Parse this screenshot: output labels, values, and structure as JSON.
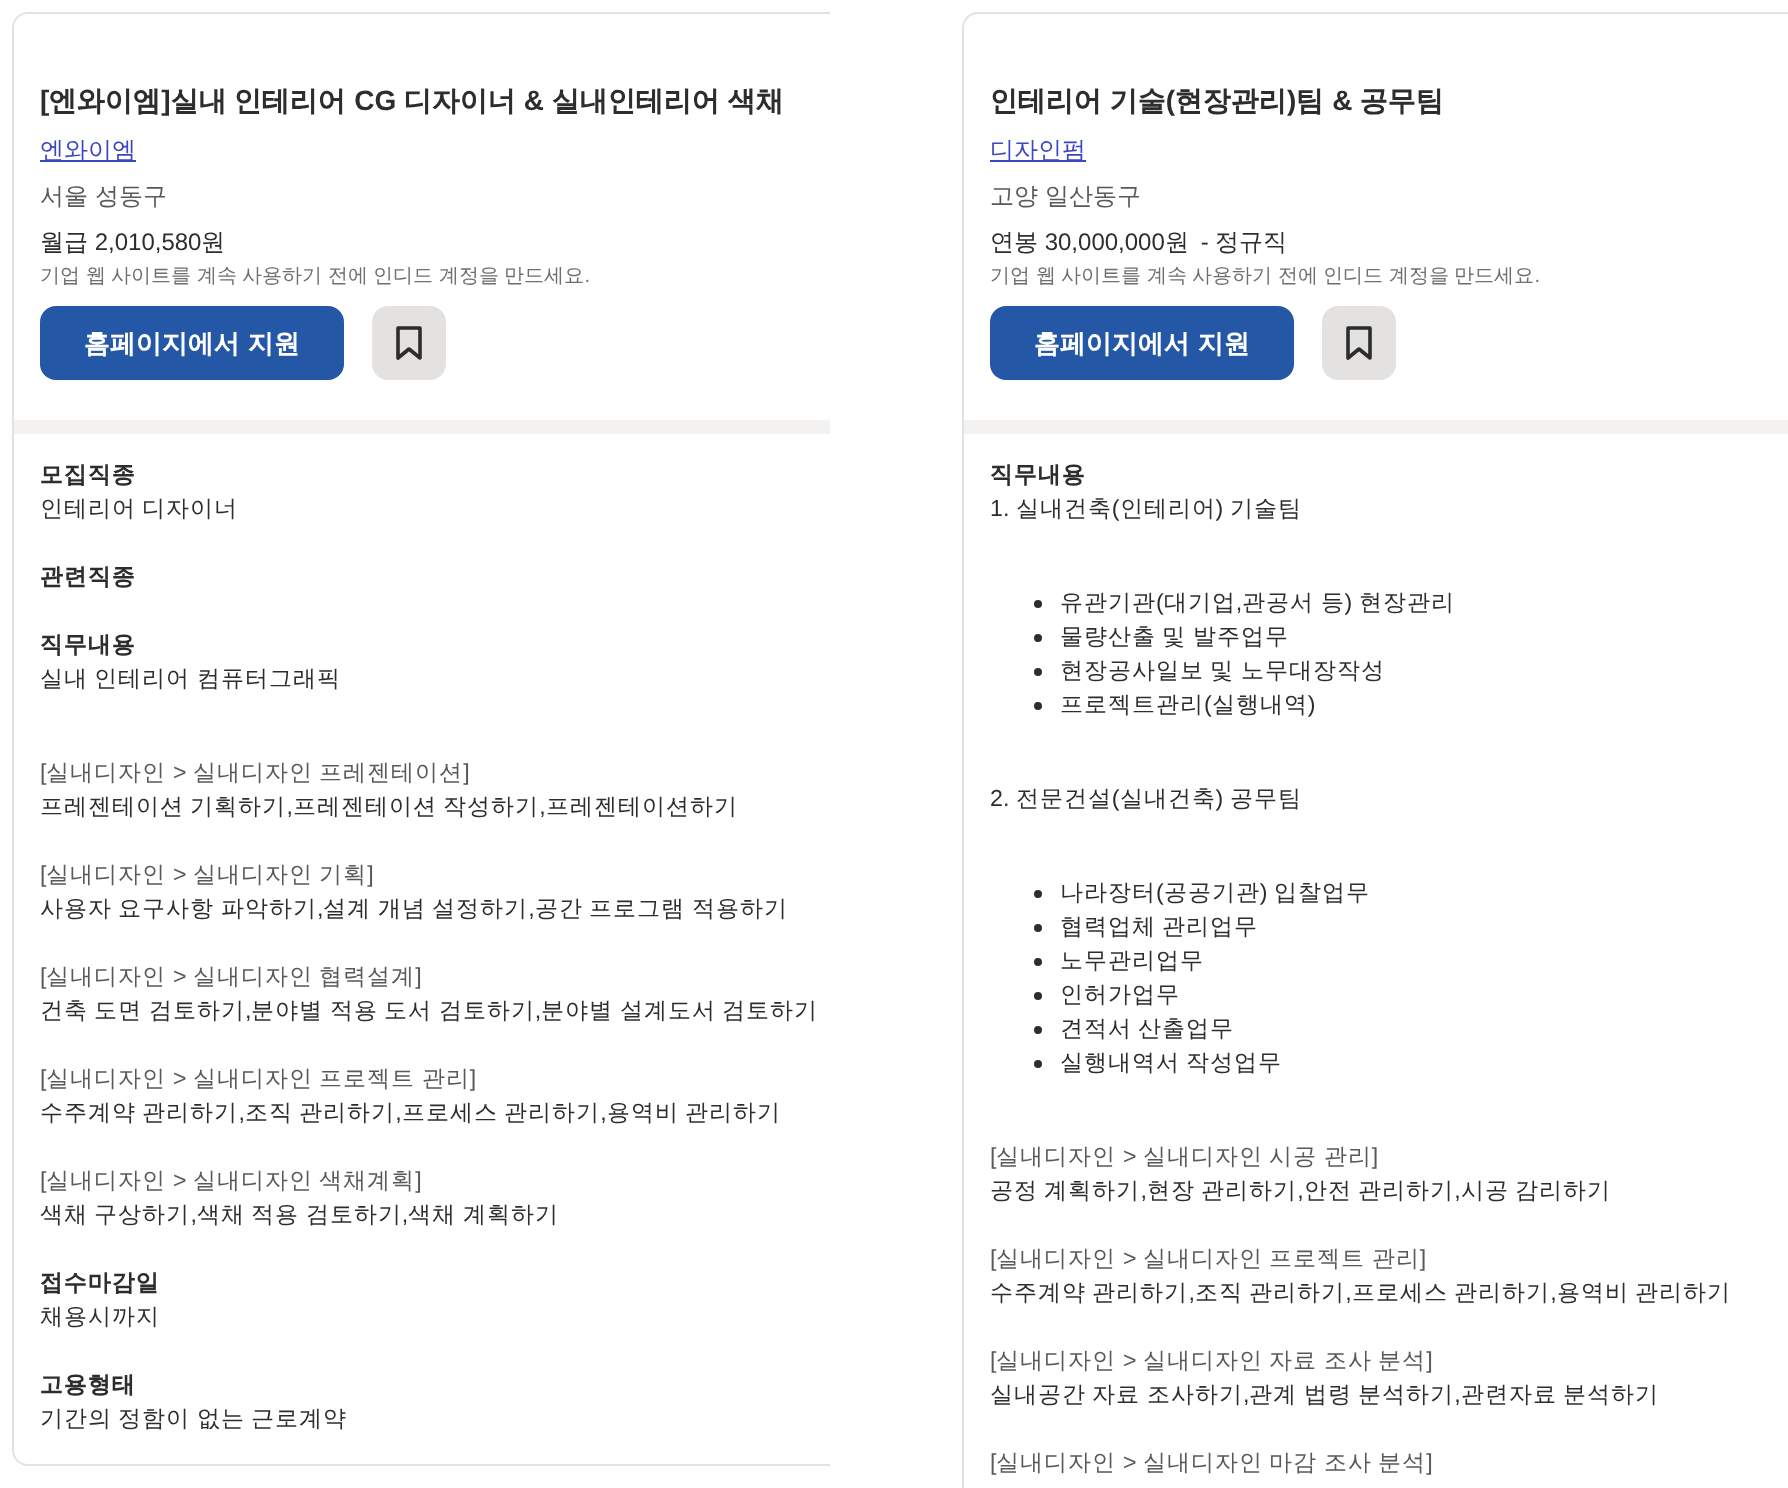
{
  "postings": [
    {
      "title": "[엔와이엠]실내 인테리어 CG 디자이너 & 실내인테리어 색채",
      "company": "엔와이엠",
      "location": "서울 성동구",
      "salary": "월급 2,010,580원",
      "notice": "기업 웹 사이트를 계속 사용하기 전에 인디드 계정을 만드세요.",
      "apply_button": "홈페이지에서 지원",
      "bookmarked": false,
      "details": [
        {
          "heading": "모집직종",
          "blocks": [
            {
              "kind": "text",
              "text": "인테리어 디자이너"
            }
          ]
        },
        {
          "heading": "관련직종"
        },
        {
          "heading": "직무내용",
          "blocks": [
            {
              "kind": "text",
              "text": "실내 인테리어 컴퓨터그래픽"
            },
            {
              "kind": "duty",
              "category": "[실내디자인 > 실내디자인 프레젠테이션]",
              "tasks": "프레젠테이션 기획하기,프레젠테이션 작성하기,프레젠테이션하기"
            },
            {
              "kind": "duty",
              "category": "[실내디자인 > 실내디자인 기획]",
              "tasks": "사용자 요구사항 파악하기,설계 개념 설정하기,공간 프로그램 적용하기"
            },
            {
              "kind": "duty",
              "category": "[실내디자인 > 실내디자인 협력설계]",
              "tasks": "건축 도면 검토하기,분야별 적용 도서 검토하기,분야별 설계도서 검토하기"
            },
            {
              "kind": "duty",
              "category": "[실내디자인 > 실내디자인 프로젝트 관리]",
              "tasks": "수주계약 관리하기,조직 관리하기,프로세스 관리하기,용역비 관리하기"
            },
            {
              "kind": "duty",
              "category": "[실내디자인 > 실내디자인 색채계획]",
              "tasks": "색채 구상하기,색채 적용 검토하기,색채 계획하기"
            }
          ]
        },
        {
          "heading": "접수마감일",
          "blocks": [
            {
              "kind": "text",
              "text": "채용시까지"
            }
          ]
        },
        {
          "heading": "고용형태",
          "blocks": [
            {
              "kind": "text",
              "text": "기간의 정함이 없는 근로계약"
            }
          ]
        }
      ]
    },
    {
      "title": "인테리어 기술(현장관리)팀 & 공무팀",
      "company": "디자인펌",
      "location": "고양 일산동구",
      "salary": "연봉 30,000,000원",
      "employment_type": "- 정규직",
      "notice": "기업 웹 사이트를 계속 사용하기 전에 인디드 계정을 만드세요.",
      "apply_button": "홈페이지에서 지원",
      "bookmarked": false,
      "details": [
        {
          "heading": "직무내용",
          "blocks": [
            {
              "kind": "text",
              "text": "1. 실내건축(인테리어) 기술팀"
            },
            {
              "kind": "list",
              "items": [
                "유관기관(대기업,관공서 등) 현장관리",
                "물량산출 및 발주업무",
                "현장공사일보 및 노무대장작성",
                "프로젝트관리(실행내역)"
              ]
            },
            {
              "kind": "text",
              "text": "2. 전문건설(실내건축) 공무팀"
            },
            {
              "kind": "list",
              "items": [
                "나라장터(공공기관) 입찰업무",
                "협력업체 관리업무",
                "노무관리업무",
                "인허가업무",
                "견적서 산출업무",
                "실행내역서 작성업무"
              ]
            },
            {
              "kind": "duty",
              "category": "[실내디자인 > 실내디자인 시공 관리]",
              "tasks": "공정 계획하기,현장 관리하기,안전 관리하기,시공 감리하기"
            },
            {
              "kind": "duty",
              "category": "[실내디자인 > 실내디자인 프로젝트 관리]",
              "tasks": "수주계약 관리하기,조직 관리하기,프로세스 관리하기,용역비 관리하기"
            },
            {
              "kind": "duty",
              "category": "[실내디자인 > 실내디자인 자료 조사 분석]",
              "tasks": "실내공간 자료 조사하기,관계 법령 분석하기,관련자료 분석하기"
            },
            {
              "kind": "duty",
              "category": "[실내디자인 > 실내디자인 마감 조사 분석]"
            }
          ]
        }
      ]
    }
  ]
}
